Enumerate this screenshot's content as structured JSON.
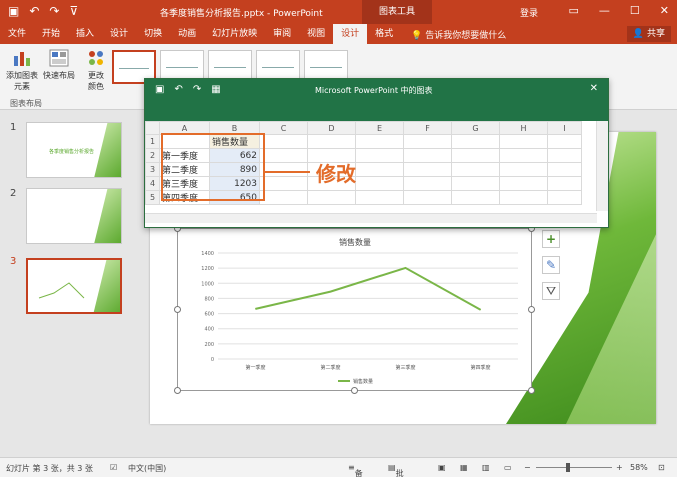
{
  "titlebar": {
    "filename": "各季度销售分析报告.pptx - PowerPoint",
    "context_tool": "图表工具",
    "login": "登录"
  },
  "tabs": [
    "文件",
    "开始",
    "插入",
    "设计",
    "切换",
    "动画",
    "幻灯片放映",
    "审阅",
    "视图",
    "设计",
    "格式"
  ],
  "active_tab_index": 9,
  "tell_me": "告诉我你想要做什么",
  "share": "共享",
  "ribbon": {
    "add_element": "添加图表\n元素",
    "quick_layout": "快速布局",
    "change_color": "更改\n颜色",
    "group_label": "图表布局"
  },
  "slides": [
    {
      "num": "1",
      "text": "各季度销售分析报告"
    },
    {
      "num": "2",
      "text": ""
    },
    {
      "num": "3",
      "text": ""
    }
  ],
  "datasheet": {
    "title": "Microsoft PowerPoint 中的图表",
    "columns": [
      "A",
      "B",
      "C",
      "D",
      "E",
      "F",
      "G",
      "H",
      "I"
    ],
    "rows": [
      {
        "num": "1",
        "a": "",
        "b": "销售数量"
      },
      {
        "num": "2",
        "a": "第一季度",
        "b": "662"
      },
      {
        "num": "3",
        "a": "第二季度",
        "b": "890"
      },
      {
        "num": "4",
        "a": "第三季度",
        "b": "1203"
      },
      {
        "num": "5",
        "a": "第四季度",
        "b": "650"
      }
    ]
  },
  "annotation": "修改",
  "chart_data": {
    "type": "line",
    "title": "销售数量",
    "categories": [
      "第一季度",
      "第二季度",
      "第三季度",
      "第四季度"
    ],
    "series": [
      {
        "name": "销售数量",
        "values": [
          662,
          890,
          1203,
          650
        ],
        "color": "#7ab648"
      }
    ],
    "yticks": [
      "0",
      "200",
      "400",
      "600",
      "800",
      "1000",
      "1200",
      "1400"
    ],
    "ylim": [
      0,
      1400
    ],
    "legend": "bottom"
  },
  "status": {
    "slide_info": "幻灯片 第 3 张，共 3 张",
    "language": "中文(中国)",
    "notes": "备注",
    "comments": "批注",
    "zoom": "58%"
  },
  "colors": {
    "accent": "#c4401f",
    "excel_green": "#217346",
    "highlight": "#e36c2a"
  }
}
